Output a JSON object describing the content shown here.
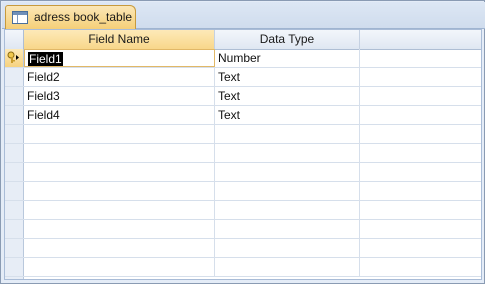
{
  "tab": {
    "label": "adress book_table",
    "icon": "table-icon"
  },
  "columns": [
    {
      "label": "Field Name"
    },
    {
      "label": "Data Type"
    },
    {
      "label": ""
    }
  ],
  "rows": [
    {
      "field": "Field1",
      "type": "Number",
      "primary_key": true
    },
    {
      "field": "Field2",
      "type": "Text"
    },
    {
      "field": "Field3",
      "type": "Text"
    },
    {
      "field": "Field4",
      "type": "Text"
    }
  ],
  "colors": {
    "accent": "#f8d78a",
    "grid": "#d6dfeb",
    "selection": "#000000"
  }
}
